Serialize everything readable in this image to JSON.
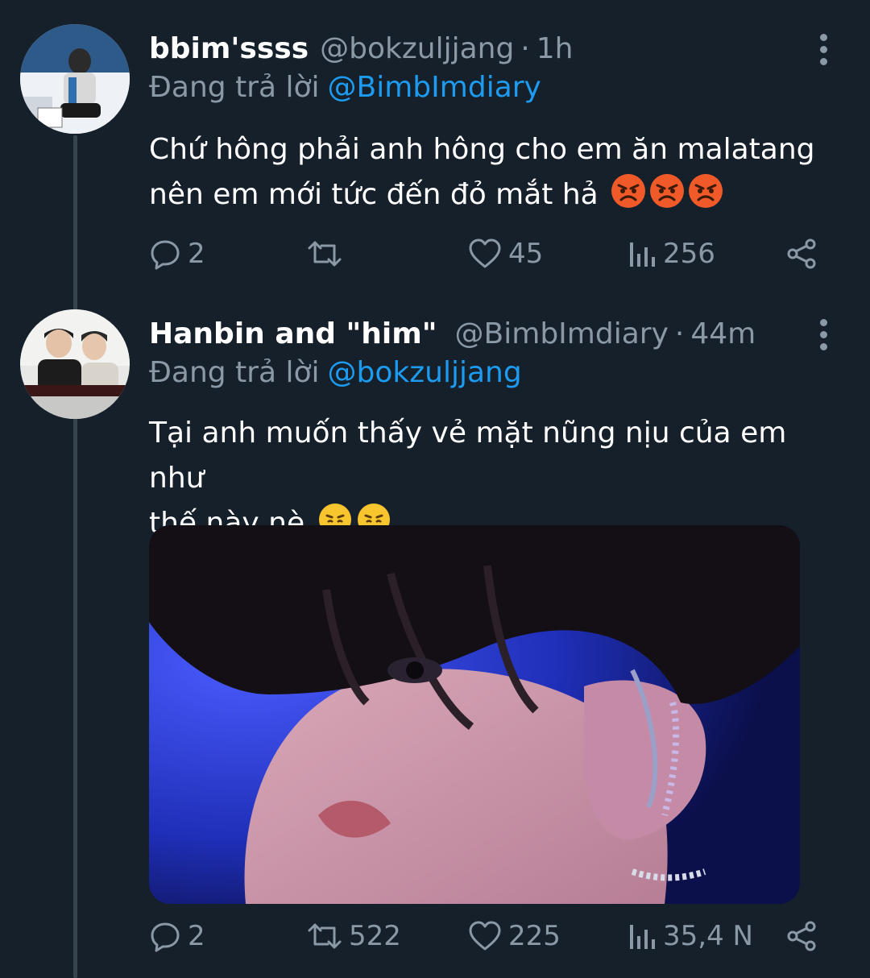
{
  "tweets": [
    {
      "display_name": "bbim'ssss",
      "handle": "@bokzuljjang",
      "separator": "·",
      "time": "1h",
      "replying_prefix": "Đang trả lời",
      "replying_to": "@BimbImdiary",
      "text_line1": "Chứ hông phải anh hông cho em ăn malatang",
      "text_line2": "nên em mới tức đến đỏ mắt hả",
      "emoji": [
        "angry-face",
        "angry-face",
        "angry-face"
      ],
      "stats": {
        "replies": "2",
        "retweets": "",
        "likes": "45",
        "views": "256"
      }
    },
    {
      "display_name": "Hanbin and \"him\"",
      "handle": "@BimbImdiary",
      "separator": "·",
      "time": "44m",
      "replying_prefix": "Đang trả lời",
      "replying_to": "@bokzuljjang",
      "text_line1": "Tại anh muốn thấy vẻ mặt nũng nịu của em như",
      "text_line2": "thế này nè",
      "emoji": [
        "steam-from-nose-face",
        "steam-from-nose-face"
      ],
      "has_media": true,
      "stats": {
        "replies": "2",
        "retweets": "522",
        "likes": "225",
        "views": "35,4 N"
      }
    }
  ],
  "colors": {
    "background": "#15202b",
    "text": "#ffffff",
    "muted": "#8b98a5",
    "accent": "#1d9bf0",
    "thread_line": "#38444d"
  },
  "icons": [
    "reply-icon",
    "retweet-icon",
    "like-icon",
    "views-icon",
    "share-icon",
    "more-icon"
  ]
}
